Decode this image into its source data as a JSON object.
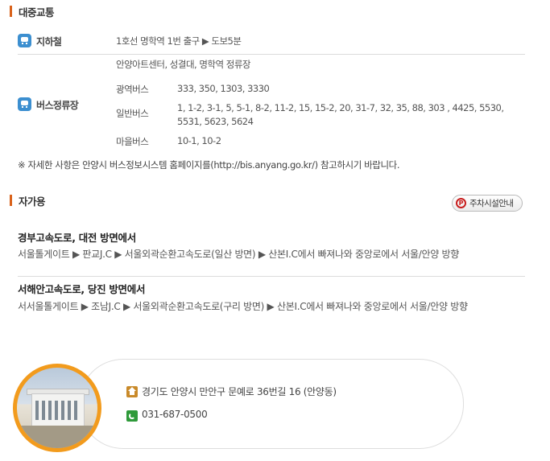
{
  "public_transit": {
    "heading": "대중교통",
    "subway": {
      "label": "지하철",
      "value": "1호선 명학역 1번 출구 ▶ 도보5분"
    },
    "bus": {
      "label": "버스정류장",
      "stops": "안양아트센터, 성결대, 명학역 정류장",
      "rows": [
        {
          "type": "광역버스",
          "routes": "333, 350, 1303, 3330"
        },
        {
          "type": "일반버스",
          "routes": "1, 1-2, 3-1, 5, 5-1, 8-2, 11-2, 15, 15-2, 20, 31-7, 32, 35, 88, 303 , 4425, 5530, 5531, 5623, 5624"
        },
        {
          "type": "마을버스",
          "routes": "10-1, 10-2"
        }
      ]
    },
    "note": "※ 자세한 사항은 안양시 버스정보시스템 홈페이지를(http://bis.anyang.go.kr/) 참고하시기 바랍니다."
  },
  "car": {
    "heading": "자가용",
    "parking_button": {
      "icon_letter": "P",
      "label": "주차시설안내"
    },
    "routes": [
      {
        "title": "경부고속도로, 대전 방면에서",
        "body": "서울톨게이트 ▶ 판교J.C ▶ 서울외곽순환고속도로(일산 방면) ▶ 산본I.C에서 빠져나와 중앙로에서 서울/안양 방향"
      },
      {
        "title": "서해안고속도로, 당진 방면에서",
        "body": "서서울톨게이트 ▶ 조남J.C ▶ 서울외곽순환고속도로(구리 방면) ▶ 산본I.C에서 빠져나와 중앙로에서 서울/안양 방향"
      }
    ]
  },
  "contact": {
    "address": "경기도 안양시 만안구 문예로 36번길 16 (안양동)",
    "phone": "031-687-0500"
  },
  "colors": {
    "accent": "#d9621b",
    "photo_ring": "#f29b1d",
    "transit_icon": "#3c8fd0",
    "home_icon": "#c98a2a",
    "phone_icon": "#2f9a3a"
  }
}
